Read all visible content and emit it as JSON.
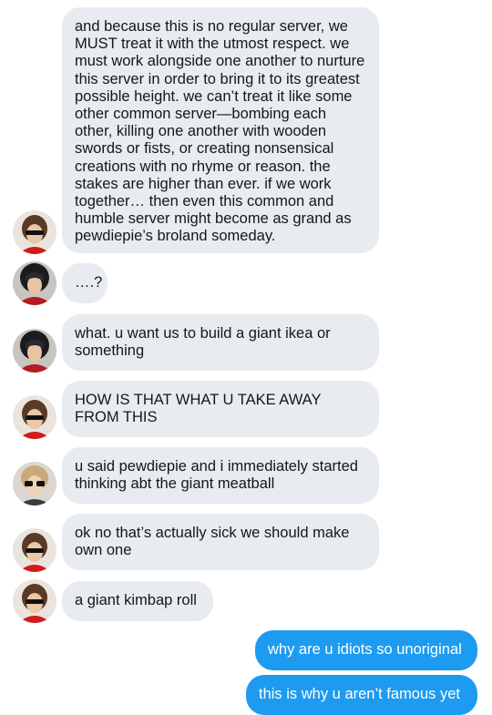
{
  "messages": [
    {
      "id": "m1",
      "direction": "incoming",
      "avatar": "avatar-red-sunglasses",
      "text": "and because this is no regular server, we MUST treat it with the utmost respect. we must work alongside one another to nurture this server in order to bring it to its greatest possible height. we can’t treat it like some other common server—bombing each other, killing one another with wooden swords or fists, or creating nonsensical creations with no rhyme or reason. the stakes are higher than ever. if we work together… then even this common and humble server might become as grand as pewdiepie’s broland someday."
    },
    {
      "id": "m2",
      "direction": "incoming",
      "avatar": "avatar-dark-hair-red",
      "text": "….?"
    },
    {
      "id": "m3",
      "direction": "incoming",
      "avatar": "avatar-dark-hair-red",
      "text": "what. u want us to build a giant ikea or something"
    },
    {
      "id": "m4",
      "direction": "incoming",
      "avatar": "avatar-red-sunglasses",
      "text": "HOW IS THAT WHAT U TAKE AWAY FROM THIS"
    },
    {
      "id": "m5",
      "direction": "incoming",
      "avatar": "avatar-blonde-glasses",
      "text": "u said pewdiepie and i immediately started thinking abt the giant meatball"
    },
    {
      "id": "m6",
      "direction": "incoming",
      "avatar": "avatar-red-sunglasses",
      "text": "ok no that’s actually sick we should make own one"
    },
    {
      "id": "m7",
      "direction": "incoming",
      "avatar": "avatar-red-sunglasses",
      "text": "a giant kimbap roll"
    },
    {
      "id": "m8",
      "direction": "outgoing",
      "text": "why are u idiots so unoriginal"
    },
    {
      "id": "m9",
      "direction": "outgoing",
      "text": "this is why u aren’t famous yet"
    }
  ],
  "colors": {
    "incoming_bubble": "#e8ecf0",
    "incoming_text": "#14171a",
    "outgoing_bubble": "#1d9bf0",
    "outgoing_text": "#ffffff"
  }
}
